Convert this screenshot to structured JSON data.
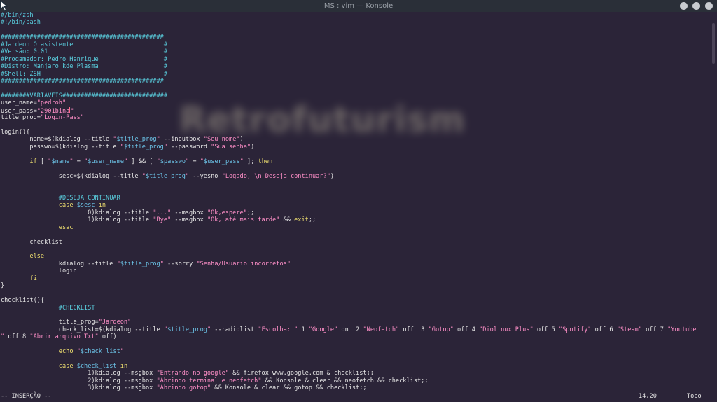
{
  "window": {
    "title": "MS : vim — Konsole"
  },
  "watermark": "Retrofuturism",
  "editor": {
    "lines": [
      [
        [
          "c",
          "#/bin/zsh"
        ]
      ],
      [
        [
          "c",
          "#!/bin/bash"
        ]
      ],
      [],
      [
        [
          "c",
          "#############################################"
        ]
      ],
      [
        [
          "c",
          "#Jardeon O asistente                         #"
        ]
      ],
      [
        [
          "c",
          "#Versão: 0.01                                #"
        ]
      ],
      [
        [
          "c",
          "#Progamador: Pedro Henrique                  #"
        ]
      ],
      [
        [
          "c",
          "#Distro: Manjaro kde Plasma                  #"
        ]
      ],
      [
        [
          "c",
          "#Shell: ZSH                                  #"
        ]
      ],
      [
        [
          "c",
          "#############################################"
        ]
      ],
      [],
      [
        [
          "c",
          "########VARIAVEIS#############################"
        ]
      ],
      [
        [
          "n",
          "user_name="
        ],
        [
          "s",
          "\"pedroh\""
        ]
      ],
      [
        [
          "n",
          "user_pass="
        ],
        [
          "s",
          "\"2901bina"
        ],
        [
          "cur",
          ""
        ],
        [
          "s",
          "\""
        ]
      ],
      [
        [
          "n",
          "title_prog="
        ],
        [
          "s",
          "\"Login-Pass\""
        ]
      ],
      [],
      [
        [
          "n",
          "login(){"
        ]
      ],
      [
        [
          "n",
          "        name=$(kdialog --title "
        ],
        [
          "s",
          "\""
        ],
        [
          "v",
          "$title_prog"
        ],
        [
          "s",
          "\""
        ],
        [
          "n",
          " --inputbox "
        ],
        [
          "s",
          "\"Seu nome\""
        ],
        [
          "n",
          ")"
        ]
      ],
      [
        [
          "n",
          "        passwo=$(kdialog --title "
        ],
        [
          "s",
          "\""
        ],
        [
          "v",
          "$title_prog"
        ],
        [
          "s",
          "\""
        ],
        [
          "n",
          " --password "
        ],
        [
          "s",
          "\"Sua senha\""
        ],
        [
          "n",
          ")"
        ]
      ],
      [],
      [
        [
          "n",
          "        "
        ],
        [
          "k",
          "if"
        ],
        [
          "n",
          " [ "
        ],
        [
          "s",
          "\""
        ],
        [
          "v",
          "$name"
        ],
        [
          "s",
          "\""
        ],
        [
          "n",
          " = "
        ],
        [
          "s",
          "\""
        ],
        [
          "v",
          "$user_name"
        ],
        [
          "s",
          "\""
        ],
        [
          "n",
          " ] && [ "
        ],
        [
          "s",
          "\""
        ],
        [
          "v",
          "$passwo"
        ],
        [
          "s",
          "\""
        ],
        [
          "n",
          " = "
        ],
        [
          "s",
          "\""
        ],
        [
          "v",
          "$user_pass"
        ],
        [
          "s",
          "\""
        ],
        [
          "n",
          " ]; "
        ],
        [
          "k",
          "then"
        ]
      ],
      [],
      [
        [
          "n",
          "                sesc=$(kdialog --title "
        ],
        [
          "s",
          "\""
        ],
        [
          "v",
          "$title_prog"
        ],
        [
          "s",
          "\""
        ],
        [
          "n",
          " --yesno "
        ],
        [
          "s",
          "\"Logado, \\n Deseja continuar?\""
        ],
        [
          "n",
          ")"
        ]
      ],
      [],
      [],
      [
        [
          "c",
          "                #DESEJA CONTINUAR"
        ]
      ],
      [
        [
          "n",
          "                "
        ],
        [
          "k",
          "case"
        ],
        [
          "n",
          " "
        ],
        [
          "v",
          "$sesc"
        ],
        [
          "n",
          " "
        ],
        [
          "k",
          "in"
        ]
      ],
      [
        [
          "n",
          "                        0)kdialog --title "
        ],
        [
          "s",
          "\"...\""
        ],
        [
          "n",
          " --msgbox "
        ],
        [
          "s",
          "\"Ok,espere\""
        ],
        [
          "n",
          ";;"
        ]
      ],
      [
        [
          "n",
          "                        1)kdialog --title "
        ],
        [
          "s",
          "\"Bye\""
        ],
        [
          "n",
          " --msgbox "
        ],
        [
          "s",
          "\"Ok, até mais tarde\""
        ],
        [
          "n",
          " && "
        ],
        [
          "k",
          "exit"
        ],
        [
          "n",
          ";;"
        ]
      ],
      [
        [
          "n",
          "                "
        ],
        [
          "k",
          "esac"
        ]
      ],
      [],
      [
        [
          "n",
          "        checklist"
        ]
      ],
      [],
      [
        [
          "n",
          "        "
        ],
        [
          "k",
          "else"
        ]
      ],
      [
        [
          "n",
          "                kdialog --title "
        ],
        [
          "s",
          "\""
        ],
        [
          "v",
          "$title_prog"
        ],
        [
          "s",
          "\""
        ],
        [
          "n",
          " --sorry "
        ],
        [
          "s",
          "\"Senha/Usuario incorretos\""
        ]
      ],
      [
        [
          "n",
          "                login"
        ]
      ],
      [
        [
          "n",
          "        "
        ],
        [
          "k",
          "fi"
        ]
      ],
      [
        [
          "n",
          "}"
        ]
      ],
      [],
      [
        [
          "n",
          "checklist(){"
        ]
      ],
      [
        [
          "c",
          "                #CHECKLIST"
        ]
      ],
      [],
      [
        [
          "n",
          "                title_prog="
        ],
        [
          "s",
          "\"Jardeon\""
        ]
      ],
      [
        [
          "n",
          "                check_list=$(kdialog --title "
        ],
        [
          "s",
          "\""
        ],
        [
          "v",
          "$title_prog"
        ],
        [
          "s",
          "\""
        ],
        [
          "n",
          " --radiolist "
        ],
        [
          "s",
          "\"Escolha: \""
        ],
        [
          "n",
          " 1 "
        ],
        [
          "s",
          "\"Google\""
        ],
        [
          "n",
          " on  2 "
        ],
        [
          "s",
          "\"Neofetch\""
        ],
        [
          "n",
          " off  3 "
        ],
        [
          "s",
          "\"Gotop\""
        ],
        [
          "n",
          " off 4 "
        ],
        [
          "s",
          "\"Diolinux Plus\""
        ],
        [
          "n",
          " off 5 "
        ],
        [
          "s",
          "\"Spotify\""
        ],
        [
          "n",
          " off 6 "
        ],
        [
          "s",
          "\"Steam\""
        ],
        [
          "n",
          " off 7 "
        ],
        [
          "s",
          "\"Youtube"
        ]
      ],
      [
        [
          "s",
          "\""
        ],
        [
          "n",
          " off 8 "
        ],
        [
          "s",
          "\"Abrir arquivo Txt\""
        ],
        [
          "n",
          " off)"
        ]
      ],
      [],
      [
        [
          "n",
          "                "
        ],
        [
          "k",
          "echo"
        ],
        [
          "n",
          " "
        ],
        [
          "s",
          "\""
        ],
        [
          "v",
          "$check_list"
        ],
        [
          "s",
          "\""
        ]
      ],
      [],
      [
        [
          "n",
          "                "
        ],
        [
          "k",
          "case"
        ],
        [
          "n",
          " "
        ],
        [
          "v",
          "$check_list"
        ],
        [
          "n",
          " "
        ],
        [
          "k",
          "in"
        ]
      ],
      [
        [
          "n",
          "                        1)kdialog --msgbox "
        ],
        [
          "s",
          "\"Entrando no google\""
        ],
        [
          "n",
          " && firefox www.google.com & checklist;;"
        ]
      ],
      [
        [
          "n",
          "                        2)kdialog --msgbox "
        ],
        [
          "s",
          "\"Abrindo terminal e neofetch\""
        ],
        [
          "n",
          " && Konsole & clear && neofetch && checklist;;"
        ]
      ],
      [
        [
          "n",
          "                        3)kdialog --msgbox "
        ],
        [
          "s",
          "\"Abrindo gotop\""
        ],
        [
          "n",
          " && Konsole & clear && gotop && checklist;;"
        ]
      ]
    ]
  },
  "status": {
    "mode": "-- INSERÇÃO --",
    "position": "14,20",
    "scroll": "Topo"
  },
  "colors": {
    "background": "#2b2438",
    "comment": "#5ad0e0",
    "string": "#ff8fc8",
    "variable": "#6cc4e8",
    "keyword": "#f0e070"
  }
}
